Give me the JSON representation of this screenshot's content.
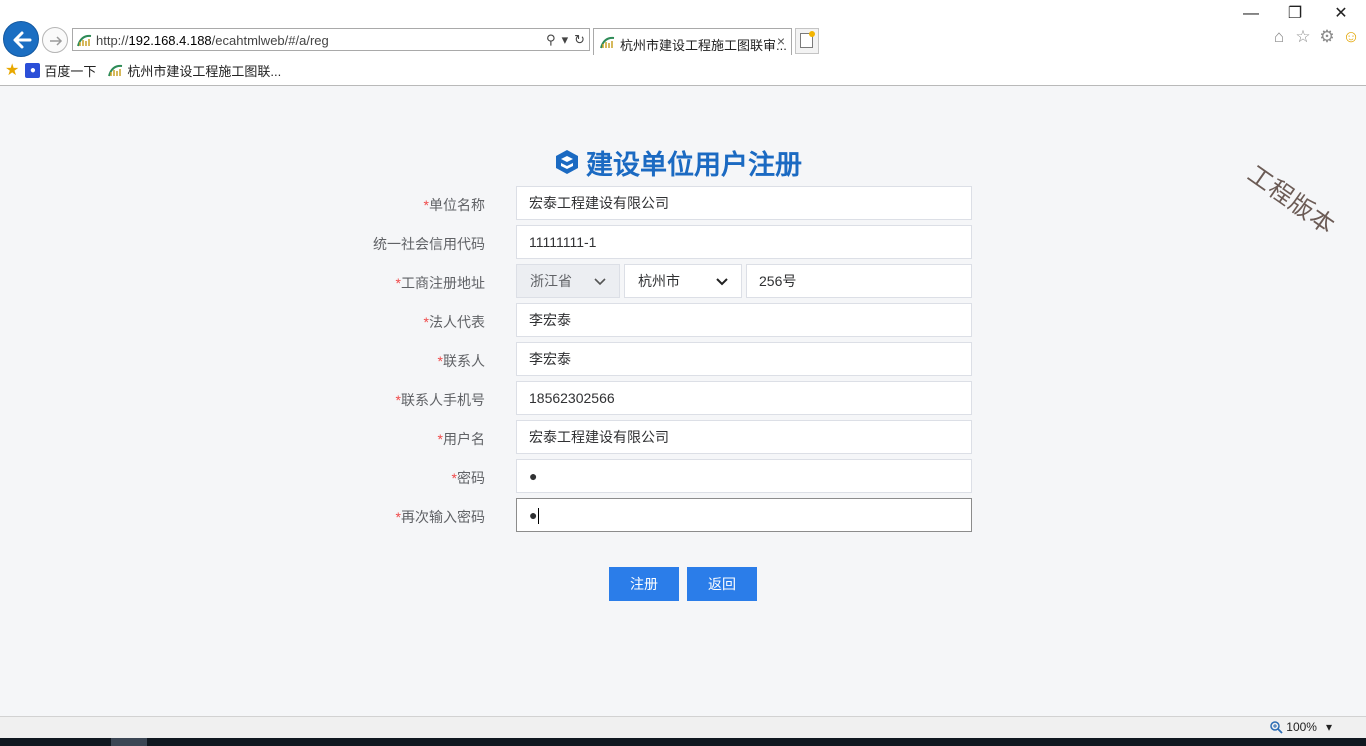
{
  "browser": {
    "url_prefix": "http://",
    "url_host": "192.168.4.188",
    "url_path": "/ecahtmlweb/#/a/reg",
    "tab_title": "杭州市建设工程施工图联审...",
    "tab_close": "×",
    "window": {
      "minimize": "—",
      "restore": "❐",
      "close": "✕"
    },
    "favorites": [
      {
        "label": "百度一下"
      },
      {
        "label": "杭州市建设工程施工图联..."
      }
    ],
    "zoom": "100%"
  },
  "watermark": "工程版本",
  "page": {
    "title": "建设单位用户注册",
    "required_mark": "*",
    "fields": [
      {
        "label": "单位名称",
        "required": true,
        "value": "宏泰工程建设有限公司"
      },
      {
        "label": "统一社会信用代码",
        "required": false,
        "value": "11111111-1"
      },
      {
        "label": "工商注册地址",
        "required": true,
        "province": "浙江省",
        "city": "杭州市",
        "value": "256号"
      },
      {
        "label": "法人代表",
        "required": true,
        "value": "李宏泰"
      },
      {
        "label": "联系人",
        "required": true,
        "value": "李宏泰"
      },
      {
        "label": "联系人手机号",
        "required": true,
        "value": "18562302566"
      },
      {
        "label": "用户名",
        "required": true,
        "value": "宏泰工程建设有限公司"
      },
      {
        "label": "密码",
        "required": true,
        "value": "●"
      },
      {
        "label": "再次输入密码",
        "required": true,
        "value": "●"
      }
    ],
    "buttons": {
      "register": "注册",
      "back": "返回"
    }
  },
  "colors": {
    "accent": "#2b7de9",
    "title": "#1b6ac2",
    "required": "#f04848"
  }
}
